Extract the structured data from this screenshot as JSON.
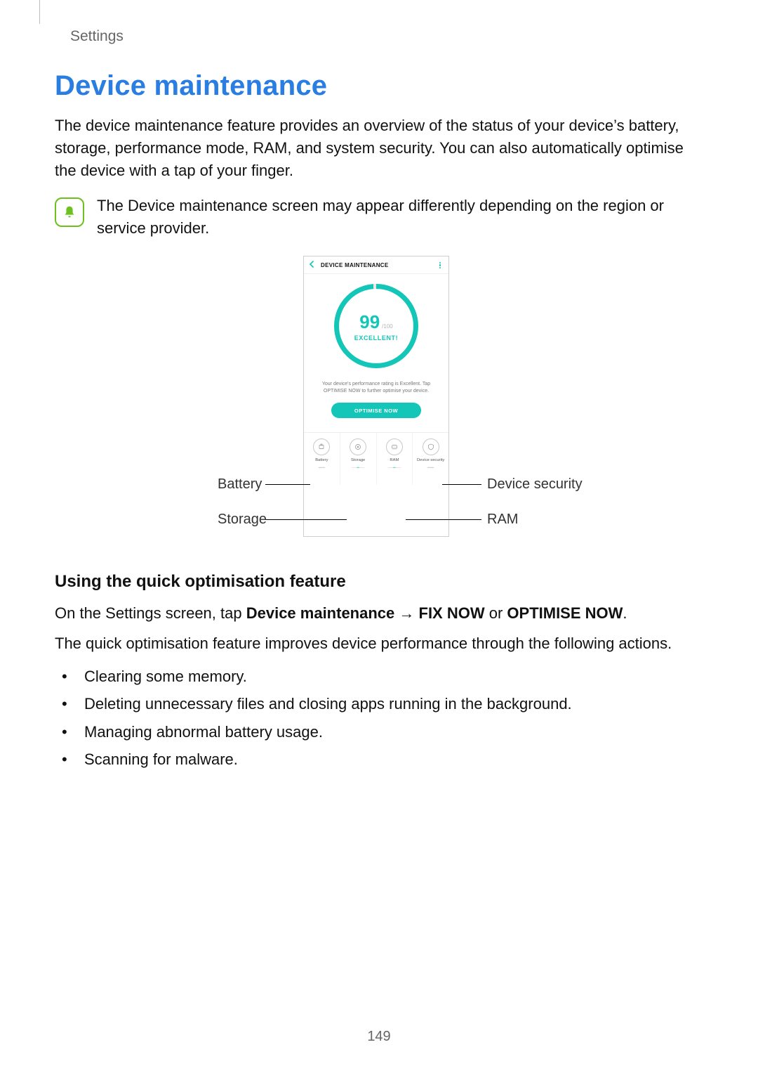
{
  "section": "Settings",
  "title": "Device maintenance",
  "intro": "The device maintenance feature provides an overview of the status of your device’s battery, storage, performance mode, RAM, and system security. You can also automatically optimise the device with a tap of your finger.",
  "note": "The Device maintenance screen may appear differently depending on the region or service provider.",
  "phone": {
    "header": "DEVICE MAINTENANCE",
    "score": "99",
    "outof": "/100",
    "rating": "EXCELLENT!",
    "desc": "Your device's performance rating is Excellent. Tap OPTIMISE NOW to further optimise your device.",
    "button": "OPTIMISE NOW",
    "tiles": {
      "battery": {
        "label": "Battery"
      },
      "storage": {
        "label": "Storage"
      },
      "ram": {
        "label": "RAM"
      },
      "security": {
        "label": "Device security"
      }
    }
  },
  "callouts": {
    "battery": "Battery",
    "storage": "Storage",
    "security": "Device security",
    "ram": "RAM"
  },
  "sub": {
    "heading": "Using the quick optimisation feature",
    "p1a": "On the Settings screen, tap ",
    "p1b": "Device maintenance",
    "p1arrow": " → ",
    "p1c": "FIX NOW",
    "p1or": " or ",
    "p1d": "OPTIMISE NOW",
    "p1e": ".",
    "p2": "The quick optimisation feature improves device performance through the following actions.",
    "items": [
      "Clearing some memory.",
      "Deleting unnecessary files and closing apps running in the background.",
      "Managing abnormal battery usage.",
      "Scanning for malware."
    ]
  },
  "pagenum": "149"
}
